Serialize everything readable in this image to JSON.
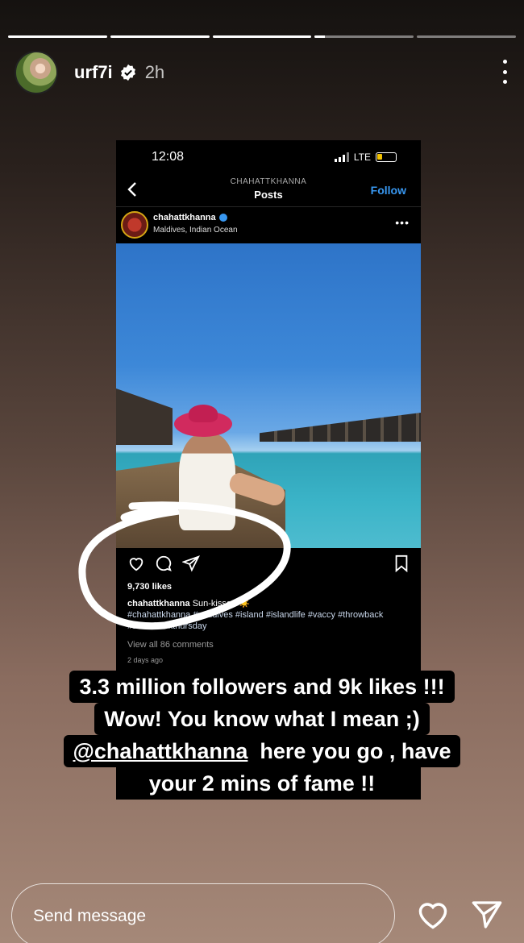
{
  "story": {
    "progress": [
      1,
      1,
      1,
      0.1,
      0
    ],
    "username": "urf7i",
    "time": "2h",
    "verified_icon": "verified-badge-icon",
    "more_icon": "vertical-dots-icon"
  },
  "screenshot": {
    "status_time": "12:08",
    "network": "LTE",
    "nav_subtitle": "CHAHATTKHANNA",
    "nav_title": "Posts",
    "follow_label": "Follow",
    "post_user": "chahattkhanna",
    "post_location": "Maldives, Indian Ocean",
    "likes": "9,730 likes",
    "caption_user": "chahattkhanna",
    "caption_text": " Sun-kissed ☀️",
    "caption_tags": "#chahattkhanna #maldives #island #islandlife #vaccy #throwback #throwbackthursday",
    "comments": "View all 86 comments",
    "ago": "2 days ago"
  },
  "overlay": {
    "line1": "3.3 million followers and 9k likes !!!",
    "line2": "Wow! You know what I mean ;)",
    "line3_mention": "@chahattkhanna",
    "line3_rest": "  here you go , have",
    "line4": "your 2 mins of fame !!"
  },
  "bottom": {
    "message_placeholder": "Send message",
    "like_icon": "heart-icon",
    "share_icon": "send-icon"
  }
}
